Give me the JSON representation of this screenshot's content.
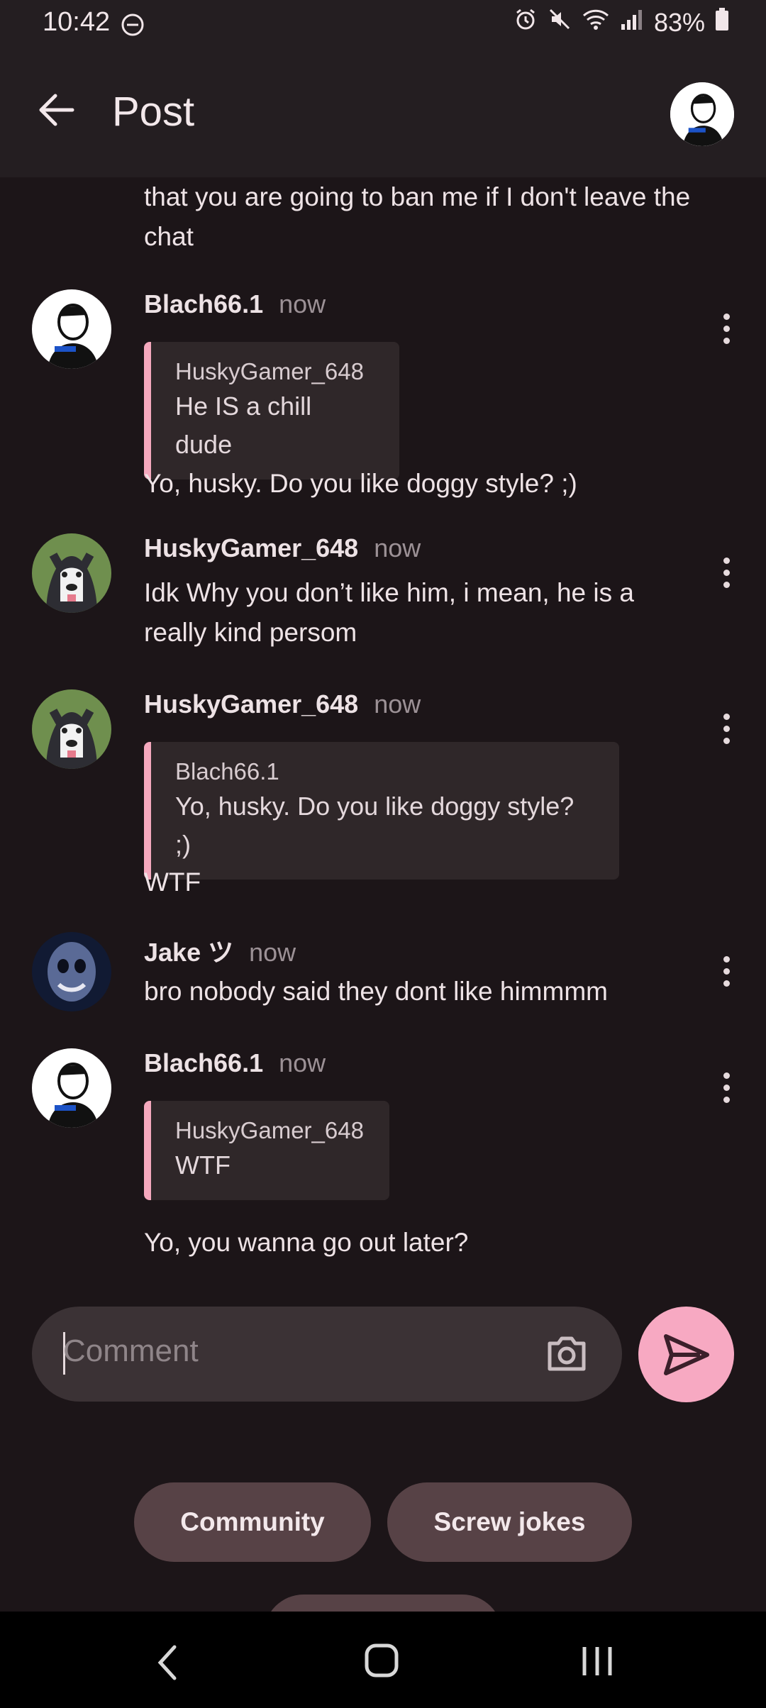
{
  "status_bar": {
    "time": "10:42",
    "battery": "83%"
  },
  "app_bar": {
    "title": "Post"
  },
  "thread": {
    "partial_text": "that you are going to ban me if I don't leave the chat",
    "comments": [
      {
        "author": "Blach66.1",
        "time": "now",
        "quote_author": "HuskyGamer_648",
        "quote_text": "He IS a chill dude",
        "text": "Yo, husky. Do you like doggy style? ;)"
      },
      {
        "author": "HuskyGamer_648",
        "time": "now",
        "text": "Idk Why you don’t like him, i mean, he is a really kind persom"
      },
      {
        "author": "HuskyGamer_648",
        "time": "now",
        "quote_author": "Blach66.1",
        "quote_text": "Yo, husky. Do you like doggy style? ;)",
        "text": "WTF"
      },
      {
        "author": "Jake ツ",
        "time": "now",
        "text": "bro nobody said they dont like himmmm"
      },
      {
        "author": "Blach66.1",
        "time": "now",
        "quote_author": "HuskyGamer_648",
        "quote_text": "WTF",
        "text": "Yo, you wanna go out later?"
      }
    ]
  },
  "composer": {
    "placeholder": "Comment"
  },
  "chips": [
    "Community",
    "Screw jokes"
  ],
  "colors": {
    "background": "#1c1518",
    "accent": "#f7a9c2",
    "chip": "#574246"
  }
}
